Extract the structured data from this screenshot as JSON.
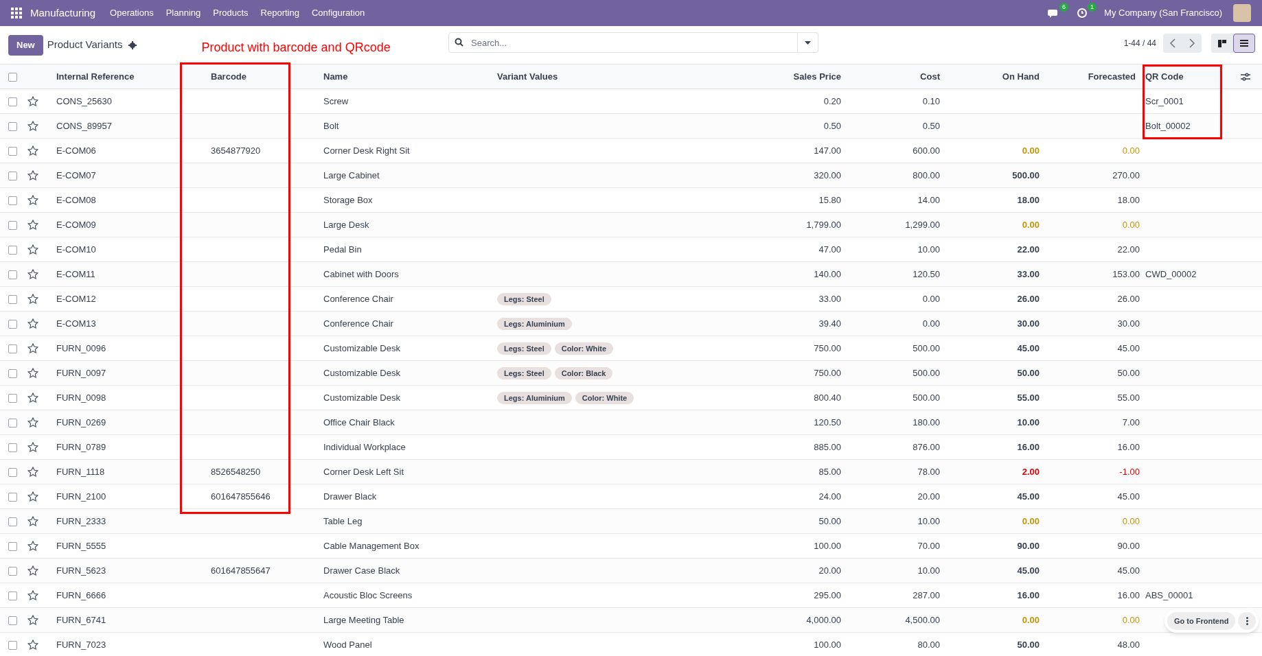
{
  "navbar": {
    "app": "Manufacturing",
    "menus": [
      "Operations",
      "Planning",
      "Products",
      "Reporting",
      "Configuration"
    ],
    "messages_count": "6",
    "activities_count": "1",
    "company": "My Company (San Francisco)"
  },
  "control_panel": {
    "new_button": "New",
    "title": "Product Variants",
    "search": {
      "placeholder": "Search..."
    },
    "pager": "1-44 / 44",
    "views": [
      {
        "kind": "kanban",
        "selected": false
      },
      {
        "kind": "list",
        "selected": true
      }
    ]
  },
  "annotation": {
    "text": "Product with barcode and QRcode"
  },
  "table": {
    "columns": [
      "Internal Reference",
      "Barcode",
      "Name",
      "Variant Values",
      "Sales Price",
      "Cost",
      "On Hand",
      "Forecasted",
      "QR Code"
    ],
    "all_checked": false,
    "rows": [
      {
        "checked": false,
        "ref": "CONS_25630",
        "barcode": "",
        "name": "Screw",
        "variants": [],
        "price": "0.20",
        "cost": "0.10",
        "on_hand": "",
        "forecasted": "",
        "qr": "Scr_0001"
      },
      {
        "checked": false,
        "ref": "CONS_89957",
        "barcode": "",
        "name": "Bolt",
        "variants": [],
        "price": "0.50",
        "cost": "0.50",
        "on_hand": "",
        "forecasted": "",
        "qr": "Bolt_00002"
      },
      {
        "checked": false,
        "ref": "E-COM06",
        "barcode": "3654877920",
        "name": "Corner Desk Right Sit",
        "variants": [],
        "price": "147.00",
        "cost": "600.00",
        "on_hand": "0.00",
        "forecasted": "0.00",
        "qr": "",
        "stock_low": true,
        "stock_negative": false
      },
      {
        "checked": false,
        "ref": "E-COM07",
        "barcode": "",
        "name": "Large Cabinet",
        "variants": [],
        "price": "320.00",
        "cost": "800.00",
        "on_hand": "500.00",
        "forecasted": "270.00",
        "qr": "",
        "stock_low": false,
        "stock_negative": false
      },
      {
        "checked": false,
        "ref": "E-COM08",
        "barcode": "",
        "name": "Storage Box",
        "variants": [],
        "price": "15.80",
        "cost": "14.00",
        "on_hand": "18.00",
        "forecasted": "18.00",
        "qr": "",
        "stock_low": false,
        "stock_negative": false
      },
      {
        "checked": false,
        "ref": "E-COM09",
        "barcode": "",
        "name": "Large Desk",
        "variants": [],
        "price": "1,799.00",
        "cost": "1,299.00",
        "on_hand": "0.00",
        "forecasted": "0.00",
        "qr": "",
        "stock_low": true,
        "stock_negative": false
      },
      {
        "checked": false,
        "ref": "E-COM10",
        "barcode": "",
        "name": "Pedal Bin",
        "variants": [],
        "price": "47.00",
        "cost": "10.00",
        "on_hand": "22.00",
        "forecasted": "22.00",
        "qr": "",
        "stock_low": false,
        "stock_negative": false
      },
      {
        "checked": false,
        "ref": "E-COM11",
        "barcode": "",
        "name": "Cabinet with Doors",
        "variants": [],
        "price": "140.00",
        "cost": "120.50",
        "on_hand": "33.00",
        "forecasted": "153.00",
        "qr": "CWD_00002",
        "stock_low": false,
        "stock_negative": false
      },
      {
        "checked": false,
        "ref": "E-COM12",
        "barcode": "",
        "name": "Conference Chair",
        "variants": [
          "Legs: Steel"
        ],
        "price": "33.00",
        "cost": "0.00",
        "on_hand": "26.00",
        "forecasted": "26.00",
        "qr": "",
        "stock_low": false,
        "stock_negative": false
      },
      {
        "checked": false,
        "ref": "E-COM13",
        "barcode": "",
        "name": "Conference Chair",
        "variants": [
          "Legs: Aluminium"
        ],
        "price": "39.40",
        "cost": "0.00",
        "on_hand": "30.00",
        "forecasted": "30.00",
        "qr": "",
        "stock_low": false,
        "stock_negative": false
      },
      {
        "checked": false,
        "ref": "FURN_0096",
        "barcode": "",
        "name": "Customizable Desk",
        "variants": [
          "Legs: Steel",
          "Color: White"
        ],
        "price": "750.00",
        "cost": "500.00",
        "on_hand": "45.00",
        "forecasted": "45.00",
        "qr": "",
        "stock_low": false,
        "stock_negative": false
      },
      {
        "checked": false,
        "ref": "FURN_0097",
        "barcode": "",
        "name": "Customizable Desk",
        "variants": [
          "Legs: Steel",
          "Color: Black"
        ],
        "price": "750.00",
        "cost": "500.00",
        "on_hand": "50.00",
        "forecasted": "50.00",
        "qr": "",
        "stock_low": false,
        "stock_negative": false
      },
      {
        "checked": false,
        "ref": "FURN_0098",
        "barcode": "",
        "name": "Customizable Desk",
        "variants": [
          "Legs: Aluminium",
          "Color: White"
        ],
        "price": "800.40",
        "cost": "500.00",
        "on_hand": "55.00",
        "forecasted": "55.00",
        "qr": "",
        "stock_low": false,
        "stock_negative": false
      },
      {
        "checked": false,
        "ref": "FURN_0269",
        "barcode": "",
        "name": "Office Chair Black",
        "variants": [],
        "price": "120.50",
        "cost": "180.00",
        "on_hand": "10.00",
        "forecasted": "7.00",
        "qr": "",
        "stock_low": false,
        "stock_negative": false
      },
      {
        "checked": false,
        "ref": "FURN_0789",
        "barcode": "",
        "name": "Individual Workplace",
        "variants": [],
        "price": "885.00",
        "cost": "876.00",
        "on_hand": "16.00",
        "forecasted": "16.00",
        "qr": "",
        "stock_low": false,
        "stock_negative": false
      },
      {
        "checked": false,
        "ref": "FURN_1118",
        "barcode": "8526548250",
        "name": "Corner Desk Left Sit",
        "variants": [],
        "price": "85.00",
        "cost": "78.00",
        "on_hand": "2.00",
        "forecasted": "-1.00",
        "qr": "",
        "stock_low": false,
        "stock_negative": true
      },
      {
        "checked": false,
        "ref": "FURN_2100",
        "barcode": "601647855646",
        "name": "Drawer Black",
        "variants": [],
        "price": "24.00",
        "cost": "20.00",
        "on_hand": "45.00",
        "forecasted": "45.00",
        "qr": "",
        "stock_low": false,
        "stock_negative": false
      },
      {
        "checked": false,
        "ref": "FURN_2333",
        "barcode": "",
        "name": "Table Leg",
        "variants": [],
        "price": "50.00",
        "cost": "10.00",
        "on_hand": "0.00",
        "forecasted": "0.00",
        "qr": "",
        "stock_low": true,
        "stock_negative": false
      },
      {
        "checked": false,
        "ref": "FURN_5555",
        "barcode": "",
        "name": "Cable Management Box",
        "variants": [],
        "price": "100.00",
        "cost": "70.00",
        "on_hand": "90.00",
        "forecasted": "90.00",
        "qr": "",
        "stock_low": false,
        "stock_negative": false
      },
      {
        "checked": false,
        "ref": "FURN_5623",
        "barcode": "601647855647",
        "name": "Drawer Case Black",
        "variants": [],
        "price": "20.00",
        "cost": "10.00",
        "on_hand": "45.00",
        "forecasted": "45.00",
        "qr": "",
        "stock_low": false,
        "stock_negative": false
      },
      {
        "checked": false,
        "ref": "FURN_6666",
        "barcode": "",
        "name": "Acoustic Bloc Screens",
        "variants": [],
        "price": "295.00",
        "cost": "287.00",
        "on_hand": "16.00",
        "forecasted": "16.00",
        "qr": "ABS_00001",
        "stock_low": false,
        "stock_negative": false
      },
      {
        "checked": false,
        "ref": "FURN_6741",
        "barcode": "",
        "name": "Large Meeting Table",
        "variants": [],
        "price": "4,000.00",
        "cost": "4,500.00",
        "on_hand": "0.00",
        "forecasted": "0.00",
        "qr": "",
        "stock_low": true,
        "stock_negative": false
      },
      {
        "checked": false,
        "ref": "FURN_7023",
        "barcode": "",
        "name": "Wood Panel",
        "variants": [],
        "price": "100.00",
        "cost": "80.00",
        "on_hand": "50.00",
        "forecasted": "48.00",
        "qr": "",
        "stock_low": false,
        "stock_negative": false
      }
    ]
  },
  "floating": {
    "button": "Go to Frontend"
  }
}
